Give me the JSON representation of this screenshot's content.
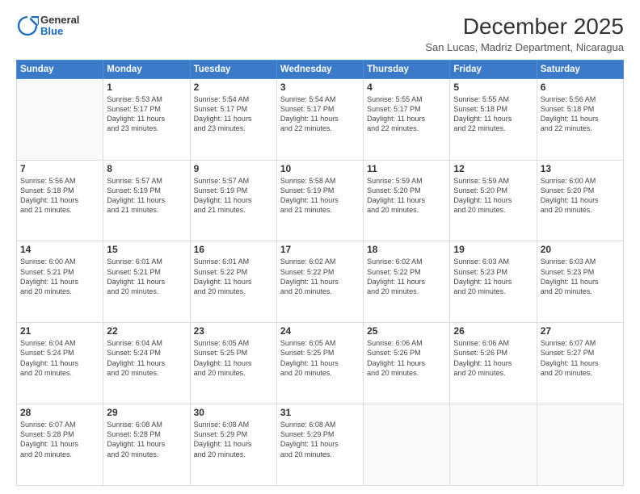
{
  "header": {
    "logo_general": "General",
    "logo_blue": "Blue",
    "month_year": "December 2025",
    "location": "San Lucas, Madriz Department, Nicaragua"
  },
  "weekdays": [
    "Sunday",
    "Monday",
    "Tuesday",
    "Wednesday",
    "Thursday",
    "Friday",
    "Saturday"
  ],
  "weeks": [
    [
      {
        "day": "",
        "info": ""
      },
      {
        "day": "1",
        "info": "Sunrise: 5:53 AM\nSunset: 5:17 PM\nDaylight: 11 hours\nand 23 minutes."
      },
      {
        "day": "2",
        "info": "Sunrise: 5:54 AM\nSunset: 5:17 PM\nDaylight: 11 hours\nand 23 minutes."
      },
      {
        "day": "3",
        "info": "Sunrise: 5:54 AM\nSunset: 5:17 PM\nDaylight: 11 hours\nand 22 minutes."
      },
      {
        "day": "4",
        "info": "Sunrise: 5:55 AM\nSunset: 5:17 PM\nDaylight: 11 hours\nand 22 minutes."
      },
      {
        "day": "5",
        "info": "Sunrise: 5:55 AM\nSunset: 5:18 PM\nDaylight: 11 hours\nand 22 minutes."
      },
      {
        "day": "6",
        "info": "Sunrise: 5:56 AM\nSunset: 5:18 PM\nDaylight: 11 hours\nand 22 minutes."
      }
    ],
    [
      {
        "day": "7",
        "info": "Sunrise: 5:56 AM\nSunset: 5:18 PM\nDaylight: 11 hours\nand 21 minutes."
      },
      {
        "day": "8",
        "info": "Sunrise: 5:57 AM\nSunset: 5:19 PM\nDaylight: 11 hours\nand 21 minutes."
      },
      {
        "day": "9",
        "info": "Sunrise: 5:57 AM\nSunset: 5:19 PM\nDaylight: 11 hours\nand 21 minutes."
      },
      {
        "day": "10",
        "info": "Sunrise: 5:58 AM\nSunset: 5:19 PM\nDaylight: 11 hours\nand 21 minutes."
      },
      {
        "day": "11",
        "info": "Sunrise: 5:59 AM\nSunset: 5:20 PM\nDaylight: 11 hours\nand 20 minutes."
      },
      {
        "day": "12",
        "info": "Sunrise: 5:59 AM\nSunset: 5:20 PM\nDaylight: 11 hours\nand 20 minutes."
      },
      {
        "day": "13",
        "info": "Sunrise: 6:00 AM\nSunset: 5:20 PM\nDaylight: 11 hours\nand 20 minutes."
      }
    ],
    [
      {
        "day": "14",
        "info": "Sunrise: 6:00 AM\nSunset: 5:21 PM\nDaylight: 11 hours\nand 20 minutes."
      },
      {
        "day": "15",
        "info": "Sunrise: 6:01 AM\nSunset: 5:21 PM\nDaylight: 11 hours\nand 20 minutes."
      },
      {
        "day": "16",
        "info": "Sunrise: 6:01 AM\nSunset: 5:22 PM\nDaylight: 11 hours\nand 20 minutes."
      },
      {
        "day": "17",
        "info": "Sunrise: 6:02 AM\nSunset: 5:22 PM\nDaylight: 11 hours\nand 20 minutes."
      },
      {
        "day": "18",
        "info": "Sunrise: 6:02 AM\nSunset: 5:22 PM\nDaylight: 11 hours\nand 20 minutes."
      },
      {
        "day": "19",
        "info": "Sunrise: 6:03 AM\nSunset: 5:23 PM\nDaylight: 11 hours\nand 20 minutes."
      },
      {
        "day": "20",
        "info": "Sunrise: 6:03 AM\nSunset: 5:23 PM\nDaylight: 11 hours\nand 20 minutes."
      }
    ],
    [
      {
        "day": "21",
        "info": "Sunrise: 6:04 AM\nSunset: 5:24 PM\nDaylight: 11 hours\nand 20 minutes."
      },
      {
        "day": "22",
        "info": "Sunrise: 6:04 AM\nSunset: 5:24 PM\nDaylight: 11 hours\nand 20 minutes."
      },
      {
        "day": "23",
        "info": "Sunrise: 6:05 AM\nSunset: 5:25 PM\nDaylight: 11 hours\nand 20 minutes."
      },
      {
        "day": "24",
        "info": "Sunrise: 6:05 AM\nSunset: 5:25 PM\nDaylight: 11 hours\nand 20 minutes."
      },
      {
        "day": "25",
        "info": "Sunrise: 6:06 AM\nSunset: 5:26 PM\nDaylight: 11 hours\nand 20 minutes."
      },
      {
        "day": "26",
        "info": "Sunrise: 6:06 AM\nSunset: 5:26 PM\nDaylight: 11 hours\nand 20 minutes."
      },
      {
        "day": "27",
        "info": "Sunrise: 6:07 AM\nSunset: 5:27 PM\nDaylight: 11 hours\nand 20 minutes."
      }
    ],
    [
      {
        "day": "28",
        "info": "Sunrise: 6:07 AM\nSunset: 5:28 PM\nDaylight: 11 hours\nand 20 minutes."
      },
      {
        "day": "29",
        "info": "Sunrise: 6:08 AM\nSunset: 5:28 PM\nDaylight: 11 hours\nand 20 minutes."
      },
      {
        "day": "30",
        "info": "Sunrise: 6:08 AM\nSunset: 5:29 PM\nDaylight: 11 hours\nand 20 minutes."
      },
      {
        "day": "31",
        "info": "Sunrise: 6:08 AM\nSunset: 5:29 PM\nDaylight: 11 hours\nand 20 minutes."
      },
      {
        "day": "",
        "info": ""
      },
      {
        "day": "",
        "info": ""
      },
      {
        "day": "",
        "info": ""
      }
    ]
  ]
}
